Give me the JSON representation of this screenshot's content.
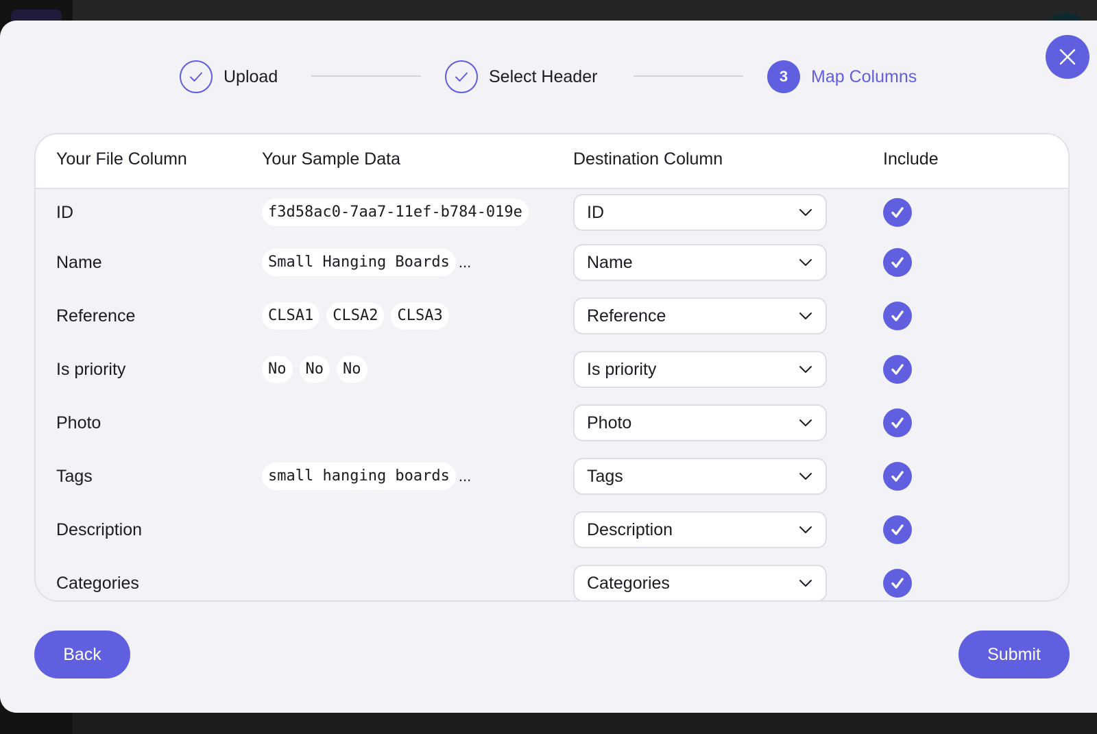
{
  "stepper": {
    "steps": [
      {
        "label": "Upload",
        "state": "done",
        "icon": "check-icon"
      },
      {
        "label": "Select Header",
        "state": "done",
        "icon": "check-icon"
      },
      {
        "label": "Map Columns",
        "state": "active",
        "number": "3"
      }
    ]
  },
  "table": {
    "headers": {
      "file_column": "Your File Column",
      "sample_data": "Your Sample Data",
      "destination": "Destination Column",
      "include": "Include"
    },
    "rows": [
      {
        "name": "ID",
        "samples": [
          "f3d58ac0-7aa7-11ef-b784-019e"
        ],
        "more": "",
        "destination": "ID",
        "include": true
      },
      {
        "name": "Name",
        "samples": [
          "Small Hanging Boards"
        ],
        "more": "...",
        "destination": "Name",
        "include": true
      },
      {
        "name": "Reference",
        "samples": [
          "CLSA1",
          "CLSA2",
          "CLSA3"
        ],
        "more": "",
        "destination": "Reference",
        "include": true
      },
      {
        "name": "Is priority",
        "samples": [
          "No",
          "No",
          "No"
        ],
        "more": "",
        "destination": "Is priority",
        "include": true
      },
      {
        "name": "Photo",
        "samples": [],
        "more": "",
        "destination": "Photo",
        "include": true
      },
      {
        "name": "Tags",
        "samples": [
          "small hanging boards"
        ],
        "more": "...",
        "destination": "Tags",
        "include": true
      },
      {
        "name": "Description",
        "samples": [],
        "more": "",
        "destination": "Description",
        "include": true
      },
      {
        "name": "Categories",
        "samples": [],
        "more": "",
        "destination": "Categories",
        "include": true
      }
    ]
  },
  "footer": {
    "back_label": "Back",
    "submit_label": "Submit"
  },
  "colors": {
    "accent": "#5f5fe0",
    "modal_bg": "#f2f2f7",
    "text": "#1b1b22",
    "backdrop": "#252525"
  }
}
